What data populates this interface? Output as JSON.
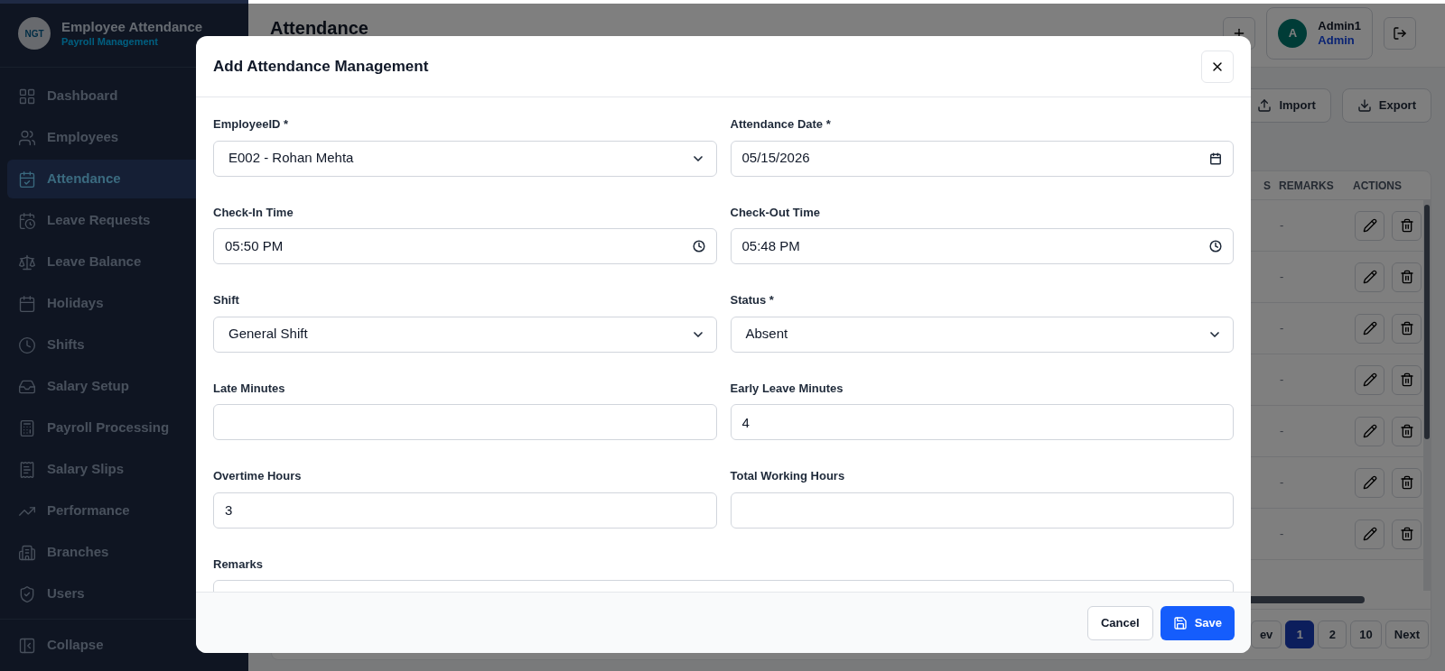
{
  "sidebar": {
    "brand": {
      "logo_text": "NGT",
      "title": "Employee Attendance",
      "subtitle": "Payroll Management"
    },
    "items": [
      {
        "label": "Dashboard",
        "selected": false
      },
      {
        "label": "Employees",
        "selected": false
      },
      {
        "label": "Attendance",
        "selected": true
      },
      {
        "label": "Leave Requests",
        "selected": false
      },
      {
        "label": "Leave Balance",
        "selected": false
      },
      {
        "label": "Holidays",
        "selected": false
      },
      {
        "label": "Shifts",
        "selected": false
      },
      {
        "label": "Salary Setup",
        "selected": false
      },
      {
        "label": "Payroll Processing",
        "selected": false
      },
      {
        "label": "Salary Slips",
        "selected": false
      },
      {
        "label": "Performance",
        "selected": false
      },
      {
        "label": "Branches",
        "selected": false
      },
      {
        "label": "Users",
        "selected": false
      }
    ],
    "collapse": "Collapse"
  },
  "header": {
    "title": "Attendance",
    "user": {
      "initial": "A",
      "name": "Admin1",
      "role": "Admin"
    }
  },
  "toolbar": [
    "Import",
    "Export"
  ],
  "table": {
    "columns": [
      "S",
      "REMARKS",
      "ACTIONS"
    ],
    "rows": [
      {
        "remarks": "-"
      },
      {
        "remarks": "-"
      },
      {
        "remarks": "-"
      },
      {
        "remarks": "-"
      },
      {
        "remarks": "-"
      },
      {
        "remarks": "-"
      },
      {
        "remarks": "-"
      }
    ]
  },
  "pagination": [
    {
      "label": "ev",
      "selected": false
    },
    {
      "label": "1",
      "selected": true
    },
    {
      "label": "2",
      "selected": false
    },
    {
      "label": "10",
      "selected": false
    },
    {
      "label": "Next",
      "selected": false
    }
  ],
  "modal": {
    "title": "Add Attendance Management",
    "fields": [
      {
        "label": "EmployeeID *",
        "kind": "select",
        "value": "E002 - Rohan Mehta"
      },
      {
        "label": "Attendance Date *",
        "kind": "date",
        "value": "05/15/2026"
      },
      {
        "label": "Check-In Time",
        "kind": "time",
        "value": "05:50 PM"
      },
      {
        "label": "Check-Out Time",
        "kind": "time",
        "value": "05:48 PM"
      },
      {
        "label": "Shift",
        "kind": "select",
        "value": "General Shift"
      },
      {
        "label": "Status *",
        "kind": "select",
        "value": "Absent"
      },
      {
        "label": "Late Minutes",
        "kind": "text"
      },
      {
        "label": "Early Leave Minutes",
        "kind": "text",
        "value": "4"
      },
      {
        "label": "Overtime Hours",
        "kind": "text",
        "value": "3"
      },
      {
        "label": "Total Working Hours",
        "kind": "text"
      },
      {
        "label": "Remarks",
        "kind": "textarea"
      }
    ],
    "buttons": {
      "cancel": "Cancel",
      "save": "Save"
    }
  }
}
